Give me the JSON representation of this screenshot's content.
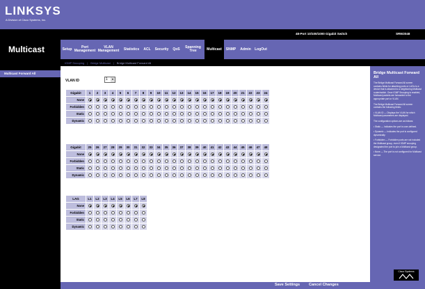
{
  "header": {
    "logo": "LINKSYS",
    "logo_sub": "A Division of Cisco Systems, Inc.",
    "product_name": "48-Port 10/100/1000 Gigabit Switch",
    "model": "SRW2048"
  },
  "section_title": "Multicast",
  "tabs": [
    {
      "label": "Setup"
    },
    {
      "label": "Port Management"
    },
    {
      "label": "VLAN Management"
    },
    {
      "label": "Statistics"
    },
    {
      "label": "ACL"
    },
    {
      "label": "Security"
    },
    {
      "label": "QoS"
    },
    {
      "label": "Spanning Tree"
    },
    {
      "label": "Multicast"
    },
    {
      "label": "SNMP"
    },
    {
      "label": "Admin"
    },
    {
      "label": "LogOut"
    }
  ],
  "subnav": {
    "item1": "IGMP Snooping",
    "item2": "Bridge Multicast",
    "item3": "Bridge Multicast Forward All",
    "sep": "|"
  },
  "left_nav": {
    "item": "Multicast Forward All"
  },
  "vlan": {
    "label": "VLAN ID",
    "value": "1"
  },
  "table1": {
    "header": "Gigabit",
    "ports": [
      "1",
      "2",
      "3",
      "4",
      "5",
      "6",
      "7",
      "8",
      "9",
      "10",
      "11",
      "12",
      "13",
      "14",
      "15",
      "16",
      "17",
      "18",
      "19",
      "20",
      "21",
      "22",
      "23",
      "24"
    ]
  },
  "table2": {
    "header": "Gigabit",
    "ports": [
      "25",
      "26",
      "27",
      "28",
      "29",
      "30",
      "31",
      "32",
      "33",
      "34",
      "35",
      "36",
      "37",
      "38",
      "39",
      "40",
      "41",
      "42",
      "43",
      "44",
      "45",
      "46",
      "47",
      "48"
    ]
  },
  "table3": {
    "header": "LAG",
    "ports": [
      "L1",
      "L2",
      "L3",
      "L4",
      "L5",
      "L6",
      "L7",
      "L8"
    ]
  },
  "row_labels": [
    "None",
    "Forbidden",
    "Static",
    "Dynamic"
  ],
  "selected_row": "None",
  "help": {
    "title": "Bridge Multicast Forward All",
    "p1": "The Bridge Multicast Forward All screen contains fields for attaching ports or LAGs to a device that is attached to a neighboring Multicast router/switch. Once IGMP Snooping is enabled, Multicast packets are forwarded to the appropriate port or VLAN.",
    "p2": "The Bridge Multicast Forward All screen contains the following fields:",
    "p3": "• VLAN ID — Displays the VLAN for which Multicast parameters are displayed.",
    "p4": "The configuration options are as follows:",
    "p5": "• Static — Indicates the port is user-defined.",
    "p6": "• Dynamic — Indicates the port is configured dynamically.",
    "p7": "• Forbidden — Forbidden ports are not included the Multicast group, even if IGMP snooping designated the port to join a Multicast group.",
    "p8": "• None — The port is not configured for Multicast service."
  },
  "support_logo": "Cisco Systems",
  "footer": {
    "save": "Save Settings",
    "cancel": "Cancel Changes"
  },
  "colors": {
    "accent": "#6666b3",
    "header_cell": "#bdbddd",
    "cell": "#d6d6ea"
  }
}
